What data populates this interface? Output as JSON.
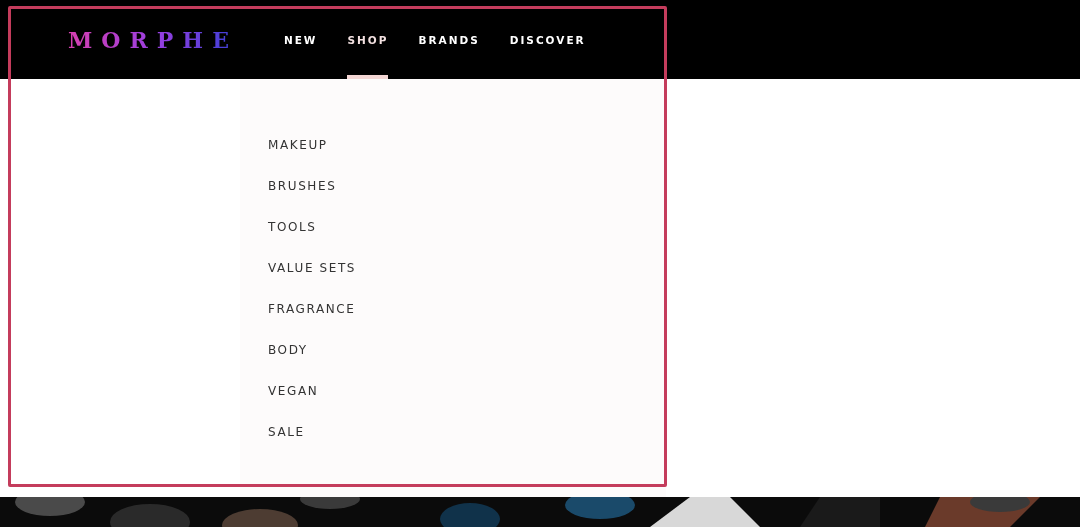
{
  "header": {
    "logo": "MORPHE",
    "nav": [
      {
        "label": "NEW",
        "selected": false
      },
      {
        "label": "SHOP",
        "selected": true
      },
      {
        "label": "BRANDS",
        "selected": false
      },
      {
        "label": "DISCOVER",
        "selected": false
      }
    ]
  },
  "menu": {
    "items": [
      "MAKEUP",
      "BRUSHES",
      "TOOLS",
      "VALUE SETS",
      "FRAGRANCE",
      "BODY",
      "VEGAN",
      "SALE"
    ]
  },
  "highlight": {
    "color": "#c43c5c"
  }
}
